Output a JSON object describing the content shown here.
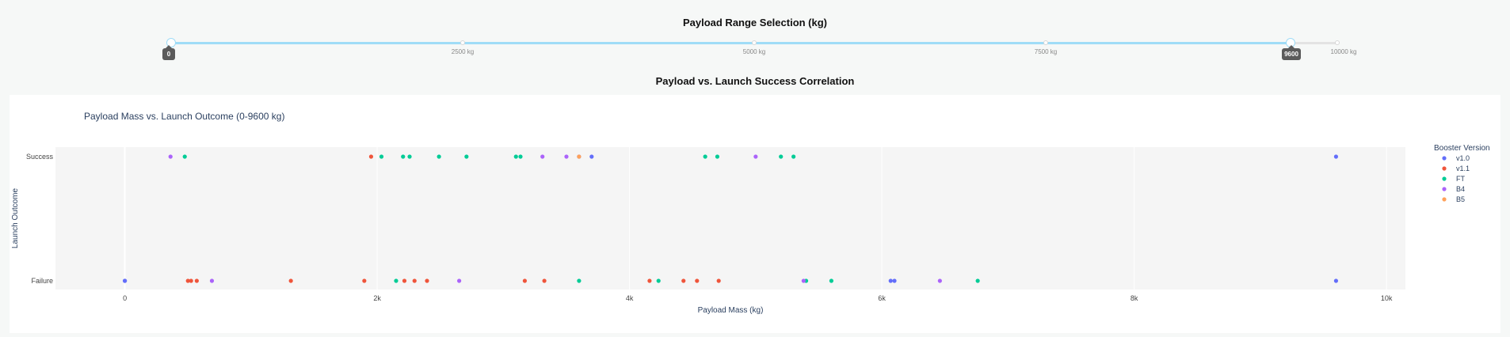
{
  "slider": {
    "title": "Payload Range Selection (kg)",
    "min": 0,
    "max": 10000,
    "selected_low": 0,
    "selected_high": 9600,
    "low_label": "0",
    "high_label": "9600",
    "marks": [
      {
        "value": 2500,
        "label": "2500 kg"
      },
      {
        "value": 5000,
        "label": "5000 kg"
      },
      {
        "value": 7500,
        "label": "7500 kg"
      },
      {
        "value": 10000,
        "label": "10000 kg"
      }
    ],
    "track_color": "#9fdcf7"
  },
  "section_title": "Payload vs. Launch Success Correlation",
  "chart_data": {
    "type": "scatter",
    "title": "Payload Mass vs. Launch Outcome (0-9600 kg)",
    "xlabel": "Payload Mass (kg)",
    "ylabel": "Launch Outcome",
    "xlim": [
      -550,
      10150
    ],
    "xticks": [
      {
        "value": 0,
        "label": "0"
      },
      {
        "value": 2000,
        "label": "2k"
      },
      {
        "value": 4000,
        "label": "4k"
      },
      {
        "value": 6000,
        "label": "6k"
      },
      {
        "value": 8000,
        "label": "8k"
      },
      {
        "value": 10000,
        "label": "10k"
      }
    ],
    "categories": [
      "Failure",
      "Success"
    ],
    "grid": true,
    "legend_title": "Booster Version",
    "legend_position": "right",
    "series": [
      {
        "name": "v1.0",
        "color": "#636efa",
        "points": [
          [
            0,
            "Failure"
          ],
          [
            0,
            "Failure"
          ],
          [
            3600,
            "Success"
          ],
          [
            3700,
            "Success"
          ],
          [
            6070,
            "Failure"
          ],
          [
            6100,
            "Failure"
          ],
          [
            9600,
            "Success"
          ],
          [
            9600,
            "Failure"
          ]
        ]
      },
      {
        "name": "v1.1",
        "color": "#ef553b",
        "points": [
          [
            500,
            "Failure"
          ],
          [
            525,
            "Failure"
          ],
          [
            570,
            "Failure"
          ],
          [
            1316,
            "Failure"
          ],
          [
            1898,
            "Failure"
          ],
          [
            1952,
            "Success"
          ],
          [
            2216,
            "Failure"
          ],
          [
            2296,
            "Failure"
          ],
          [
            2395,
            "Failure"
          ],
          [
            3170,
            "Failure"
          ],
          [
            3325,
            "Failure"
          ],
          [
            4159,
            "Failure"
          ],
          [
            4428,
            "Failure"
          ],
          [
            4535,
            "Failure"
          ],
          [
            4707,
            "Failure"
          ]
        ]
      },
      {
        "name": "FT",
        "color": "#00cc96",
        "points": [
          [
            475,
            "Success"
          ],
          [
            2034,
            "Success"
          ],
          [
            2150,
            "Failure"
          ],
          [
            2205,
            "Success"
          ],
          [
            2257,
            "Success"
          ],
          [
            2490,
            "Success"
          ],
          [
            2708,
            "Success"
          ],
          [
            3100,
            "Success"
          ],
          [
            3136,
            "Success"
          ],
          [
            3600,
            "Failure"
          ],
          [
            4230,
            "Failure"
          ],
          [
            4600,
            "Success"
          ],
          [
            4696,
            "Success"
          ],
          [
            5200,
            "Success"
          ],
          [
            5300,
            "Success"
          ],
          [
            5400,
            "Failure"
          ],
          [
            5600,
            "Failure"
          ],
          [
            6760,
            "Failure"
          ]
        ]
      },
      {
        "name": "B4",
        "color": "#ab63fa",
        "points": [
          [
            362,
            "Success"
          ],
          [
            690,
            "Failure"
          ],
          [
            2650,
            "Failure"
          ],
          [
            3310,
            "Success"
          ],
          [
            3500,
            "Success"
          ],
          [
            5000,
            "Success"
          ],
          [
            5380,
            "Failure"
          ],
          [
            6460,
            "Failure"
          ]
        ]
      },
      {
        "name": "B5",
        "color": "#ffa15a",
        "points": [
          [
            3600,
            "Success"
          ]
        ]
      }
    ]
  }
}
